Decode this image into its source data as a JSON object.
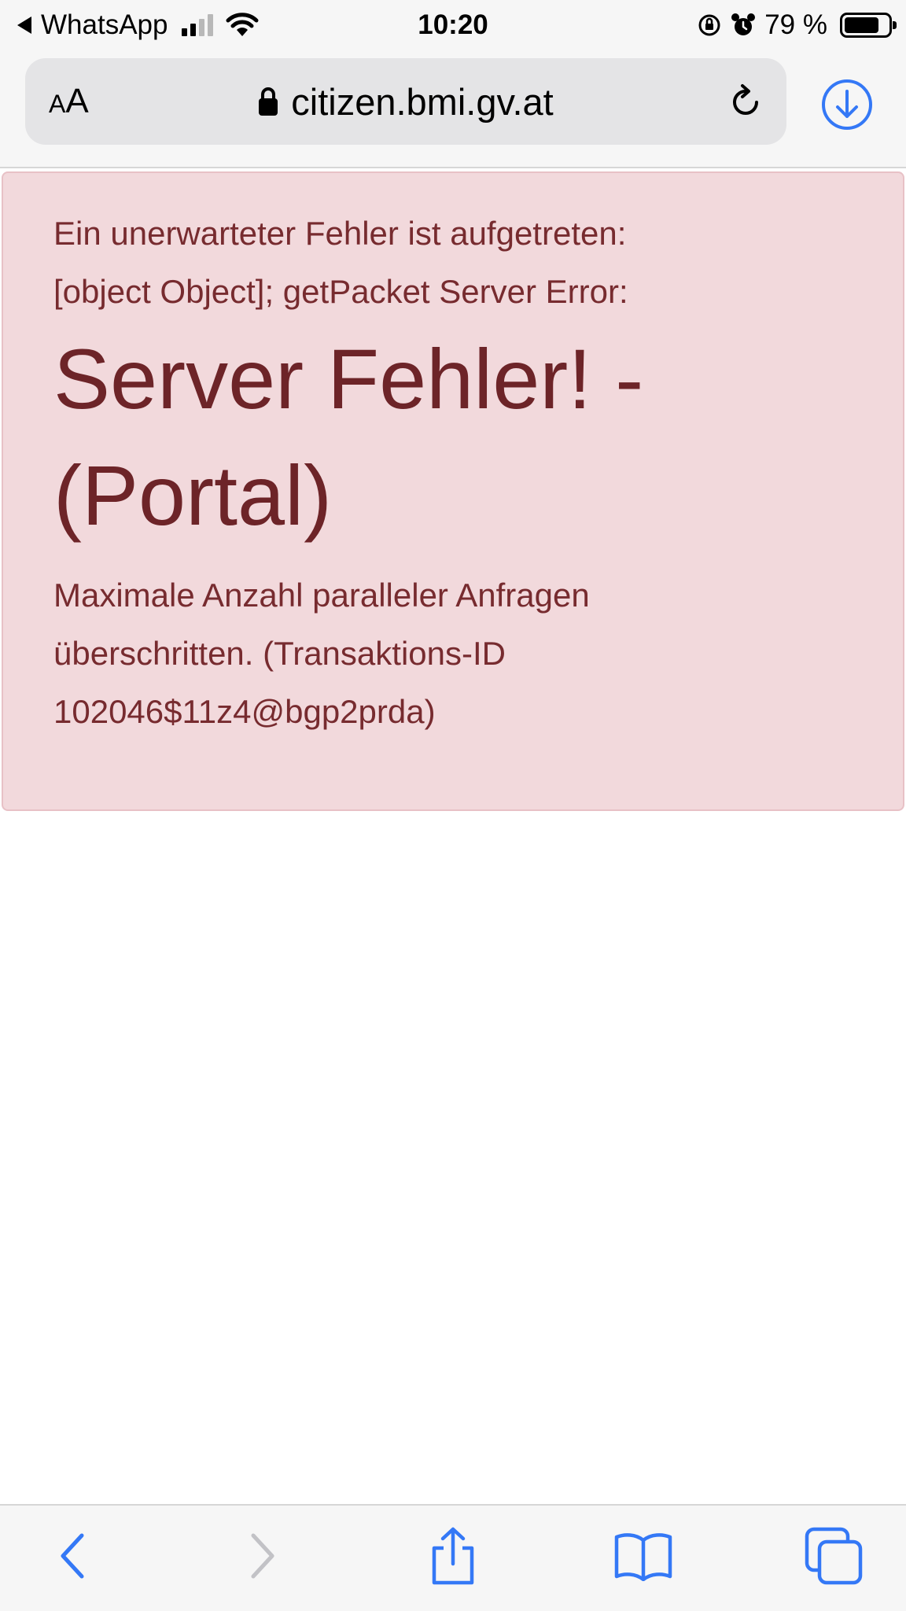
{
  "status_bar": {
    "back_app": "WhatsApp",
    "time": "10:20",
    "battery_percent": "79 %",
    "battery_level": 0.79,
    "signal_bars_active": 2,
    "signal_bars_total": 4
  },
  "browser": {
    "text_size_label_small": "A",
    "text_size_label_large": "A",
    "url": "citizen.bmi.gv.at",
    "accent_color": "#3478f6"
  },
  "alert": {
    "line1": "Ein unerwarteter Fehler ist aufgetreten:",
    "line2": "[object Object]; getPacket Server Error:",
    "heading": "Server Fehler! - (Portal)",
    "message": "Maximale Anzahl paralleler Anfragen überschritten. (Transaktions-ID 102046$11z4@bgp2prda)",
    "background_color": "#f2d9dc",
    "text_color": "#772b2f"
  },
  "toolbar": {
    "icons": [
      "back-icon",
      "forward-icon",
      "share-icon",
      "bookmarks-icon",
      "tabs-icon"
    ]
  }
}
